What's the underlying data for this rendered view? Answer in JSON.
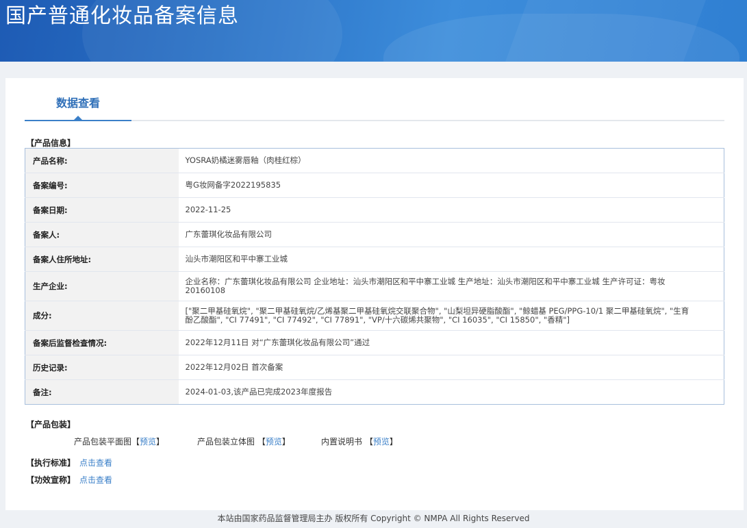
{
  "header": {
    "title": "国产普通化妆品备案信息"
  },
  "tabs": [
    {
      "label": "数据查看",
      "active": true
    }
  ],
  "product_info": {
    "section_title": "【产品信息】",
    "rows": [
      {
        "label": "产品名称:",
        "value": "YOSRA奶橘迷雾唇釉（肉桂红棕）"
      },
      {
        "label": "备案编号:",
        "value": "粤G妆网备字2022195835"
      },
      {
        "label": "备案日期:",
        "value": "2022-11-25"
      },
      {
        "label": "备案人:",
        "value": "广东蕾琪化妆品有限公司"
      },
      {
        "label": "备案人住所地址:",
        "value": "汕头市潮阳区和平中寨工业城"
      },
      {
        "label": "生产企业:",
        "value": "企业名称：广东蕾琪化妆品有限公司 企业地址：汕头市潮阳区和平中寨工业城 生产地址：汕头市潮阳区和平中寨工业城 生产许可证：粤妆20160108"
      },
      {
        "label": "成分:",
        "value": "[\"聚二甲基硅氧烷\", \"聚二甲基硅氧烷/乙烯基聚二甲基硅氧烷交联聚合物\", \"山梨坦异硬脂酸酯\", \"鲸蜡基 PEG/PPG-10/1 聚二甲基硅氧烷\", \"生育酚乙酸酯\", \"CI 77491\", \"CI 77492\", \"CI 77891\", \"VP/十六碳烯共聚物\", \"CI 16035\", \"CI 15850\", \"香精\"]"
      },
      {
        "label": "备案后监督检查情况:",
        "value": "2022年12月11日 对“广东蕾琪化妆品有限公司”通过"
      },
      {
        "label": "历史记录:",
        "value": "2022年12月02日 首次备案"
      },
      {
        "label": "备注:",
        "value": "2024-01-03,该产品已完成2023年度报告"
      }
    ]
  },
  "packaging": {
    "section_title": "【产品包装】",
    "items": [
      {
        "label": "产品包装平面图",
        "open": "【",
        "link": "预览",
        "close": "】"
      },
      {
        "label": "产品包装立体图",
        "open": "【",
        "link": "预览",
        "close": "】"
      },
      {
        "label": "内置说明书",
        "open": "【",
        "link": "预览",
        "close": "】"
      }
    ]
  },
  "standards": {
    "label": "【执行标准】",
    "link": "点击查看"
  },
  "efficacy": {
    "label": "【功效宣称】",
    "link": "点击查看"
  },
  "footer": {
    "text": "本站由国家药品监督管理局主办 版权所有 Copyright © NMPA All Rights Reserved"
  },
  "colors": {
    "accent": "#3a7fc8",
    "banner": "#2a72c6"
  }
}
